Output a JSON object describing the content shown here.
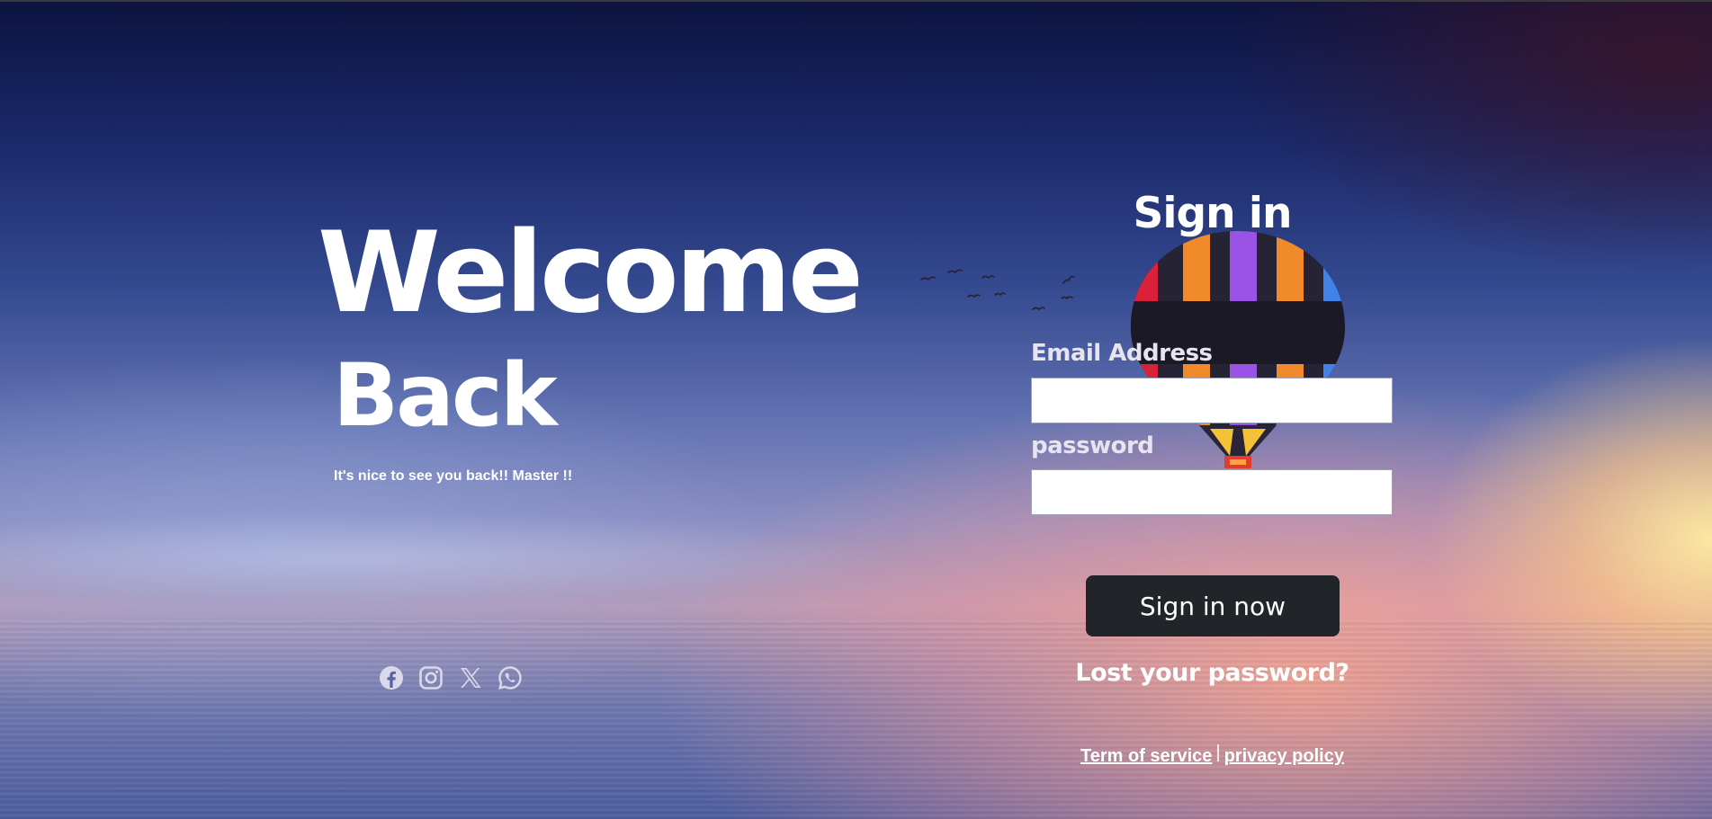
{
  "hero": {
    "title_line1": "Welcome",
    "title_line2": "Back",
    "tagline": "It's nice to see you back!! Master !!"
  },
  "social": [
    {
      "name": "facebook-icon"
    },
    {
      "name": "instagram-icon"
    },
    {
      "name": "x-icon"
    },
    {
      "name": "whatsapp-icon"
    }
  ],
  "form": {
    "title": "Sign in",
    "email_label": "Email Address",
    "email_value": "",
    "email_placeholder": "",
    "password_label": "password",
    "password_value": "",
    "password_placeholder": "",
    "submit_label": "Sign in now",
    "lost_password": "Lost your password?"
  },
  "legal": {
    "terms": "Term of service",
    "separator": "|",
    "privacy": "privacy policy"
  },
  "colors": {
    "button_bg": "#212529",
    "text": "#ffffff",
    "icon": "#d9d9ea"
  }
}
